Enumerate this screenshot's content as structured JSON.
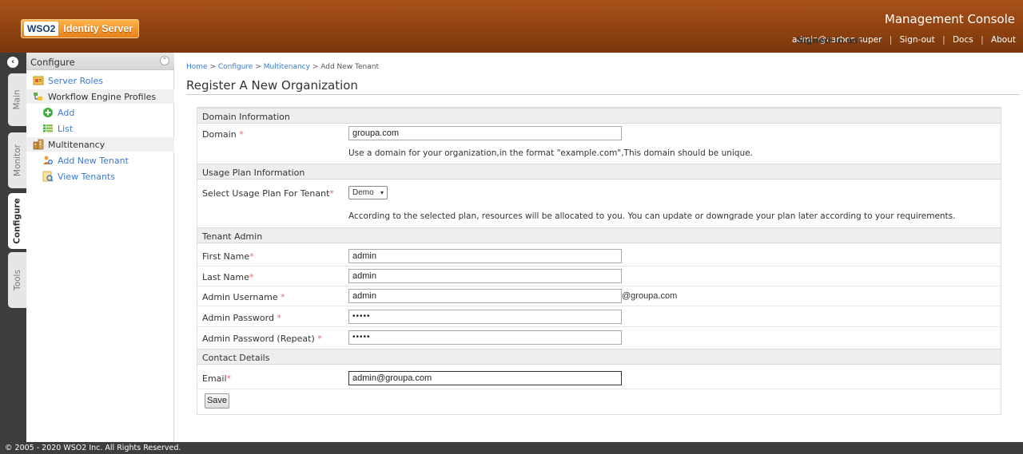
{
  "header": {
    "logo_wso2": "WSO2",
    "logo_product": "Identity Server",
    "console_title": "Management Console",
    "signed_in_label": "Signed-in as:",
    "signed_in_user": "admin@carbon.super",
    "links": [
      "Sign-out",
      "Docs",
      "About"
    ],
    "separator": "|"
  },
  "vtabs": {
    "items": [
      "Main",
      "Monitor",
      "Configure",
      "Tools"
    ],
    "active": "Configure"
  },
  "sidebar": {
    "title": "Configure",
    "items": [
      {
        "label": "Server Roles",
        "icon": "server-roles-icon"
      },
      {
        "label": "Workflow Engine Profiles",
        "icon": "workflow-icon"
      },
      {
        "label": "Add",
        "icon": "add-icon"
      },
      {
        "label": "List",
        "icon": "list-icon"
      },
      {
        "label": "Multitenancy",
        "icon": "multitenancy-icon"
      },
      {
        "label": "Add New Tenant",
        "icon": "add-tenant-icon"
      },
      {
        "label": "View Tenants",
        "icon": "view-tenants-icon"
      }
    ]
  },
  "main": {
    "breadcrumb": [
      "Home",
      "Configure",
      "Multitenancy",
      "Add New Tenant"
    ],
    "breadcrumb_sep": " > ",
    "page_title": "Register A New Organization",
    "sections": {
      "domain": "Domain Information",
      "usage": "Usage Plan Information",
      "admin": "Tenant Admin",
      "contact": "Contact Details"
    },
    "fields": {
      "domain_label": "Domain",
      "domain_value": "groupa.com",
      "domain_hint": "Use a domain for your organization,in the format \"example.com\",This domain should be unique.",
      "plan_label": "Select Usage Plan For Tenant",
      "plan_value": "Demo",
      "plan_hint": "According to the selected plan, resources will be allocated to you. You can update or downgrade your plan later according to your requirements.",
      "first_name_label": "First Name",
      "first_name_value": "admin",
      "last_name_label": "Last Name",
      "last_name_value": "admin",
      "username_label": "Admin Username",
      "username_value": "admin",
      "username_suffix": "@groupa.com",
      "password_label": "Admin Password",
      "password_value": "•••••",
      "password_repeat_label": "Admin Password (Repeat)",
      "password_repeat_value": "•••••",
      "email_label": "Email",
      "email_value": "admin@groupa.com"
    },
    "required_mark": "*",
    "save_label": "Save"
  },
  "footer": {
    "copyright": "© 2005 - 2020 WSO2 Inc. All Rights Reserved."
  }
}
